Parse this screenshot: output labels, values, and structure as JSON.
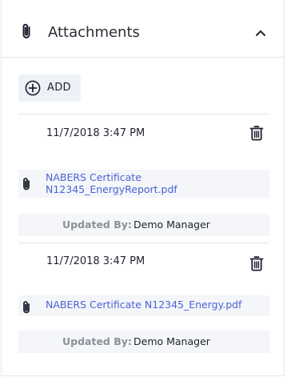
{
  "panel": {
    "title": "Attachments",
    "header_icon": "paperclip-icon",
    "collapse_icon": "chevron-up-icon"
  },
  "toolbar": {
    "add_label": "ADD",
    "add_icon": "plus-circle-icon"
  },
  "attachments": [
    {
      "date": "11/7/2018 3:47 PM",
      "file_name_line1": "NABERS Certificate",
      "file_name_line2": "N12345_EnergyReport.pdf",
      "updated_by_label": "Updated By:",
      "updated_by": "Demo Manager"
    },
    {
      "date": "11/7/2018 3:47 PM",
      "file_name_line1": "NABERS Certificate N12345_Energy.pdf",
      "file_name_line2": "",
      "updated_by_label": "Updated By:",
      "updated_by": "Demo Manager"
    }
  ],
  "colors": {
    "link": "#4a63d6",
    "text": "#1f2230",
    "muted": "#8b9099",
    "row_bg": "#f4f6f9",
    "border": "#e4e6ea"
  }
}
